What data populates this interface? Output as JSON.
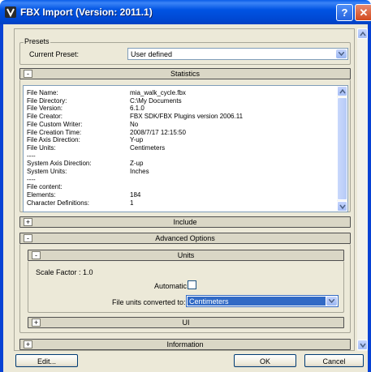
{
  "window": {
    "title": "FBX Import (Version: 2011.1)",
    "help_glyph": "?",
    "close_glyph": "✕"
  },
  "presets": {
    "legend": "Presets",
    "current_label": "Current Preset:",
    "current_value": "User defined"
  },
  "statistics": {
    "title": "Statistics",
    "toggle": "-",
    "rows": [
      {
        "k": "File Name:",
        "v": "mia_walk_cycle.fbx"
      },
      {
        "k": "File Directory:",
        "v": "C:\\My Documents"
      },
      {
        "k": "File Version:",
        "v": "6.1.0"
      },
      {
        "k": "File Creator:",
        "v": "FBX SDK/FBX Plugins version 2006.11"
      },
      {
        "k": "File Custom Writer:",
        "v": "No"
      },
      {
        "k": "File Creation Time:",
        "v": "2008/7/17  12:15:50"
      },
      {
        "k": "File Axis Direction:",
        "v": "Y-up"
      },
      {
        "k": "File Units:",
        "v": "Centimeters"
      },
      {
        "k": "----",
        "v": ""
      },
      {
        "k": "System Axis Direction:",
        "v": "Z-up"
      },
      {
        "k": "System Units:",
        "v": "Inches"
      },
      {
        "k": "----",
        "v": ""
      },
      {
        "k": "File content:",
        "v": ""
      },
      {
        "k": "Elements:",
        "v": "184"
      },
      {
        "k": "Character Definitions:",
        "v": "1"
      }
    ]
  },
  "include": {
    "title": "Include",
    "toggle": "+"
  },
  "advanced": {
    "title": "Advanced Options",
    "toggle": "-"
  },
  "units": {
    "title": "Units",
    "toggle": "-",
    "scale_factor": "Scale Factor : 1.0",
    "automatic_label": "Automatic",
    "automatic_checked": false,
    "converted_label": "File units converted to:",
    "converted_value": "Centimeters"
  },
  "ui": {
    "title": "UI",
    "toggle": "+"
  },
  "information": {
    "title": "Information",
    "toggle": "+"
  },
  "buttons": {
    "edit": "Edit...",
    "ok": "OK",
    "cancel": "Cancel"
  },
  "colors": {
    "titlebar": "#0054e3",
    "highlight": "#316ac5",
    "face": "#ece9d8"
  }
}
